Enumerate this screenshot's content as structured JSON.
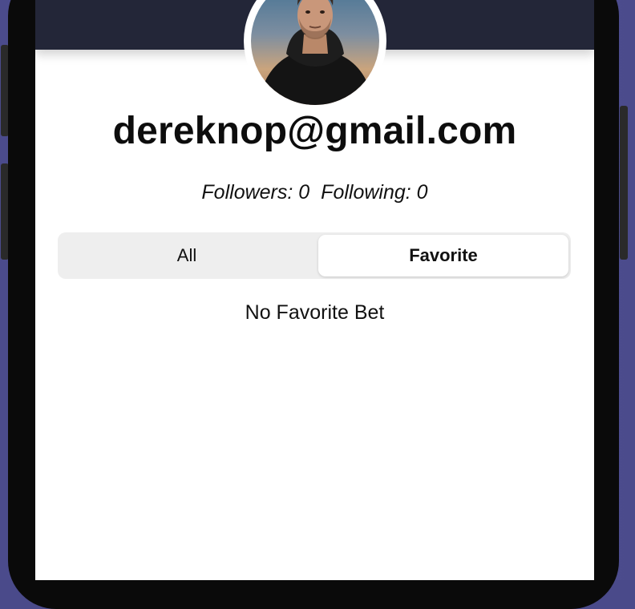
{
  "profile": {
    "email": "dereknop@gmail.com",
    "followers": "Followers: 0",
    "following": "Following: 0"
  },
  "tabs": {
    "all_label": "All",
    "favorite_label": "Favorite",
    "selected": "Favorite"
  },
  "favorites": {
    "empty_message": "No Favorite Bet"
  },
  "colors": {
    "header": "#232638",
    "background": "#ffffff",
    "segment_track": "#eeeeee"
  }
}
